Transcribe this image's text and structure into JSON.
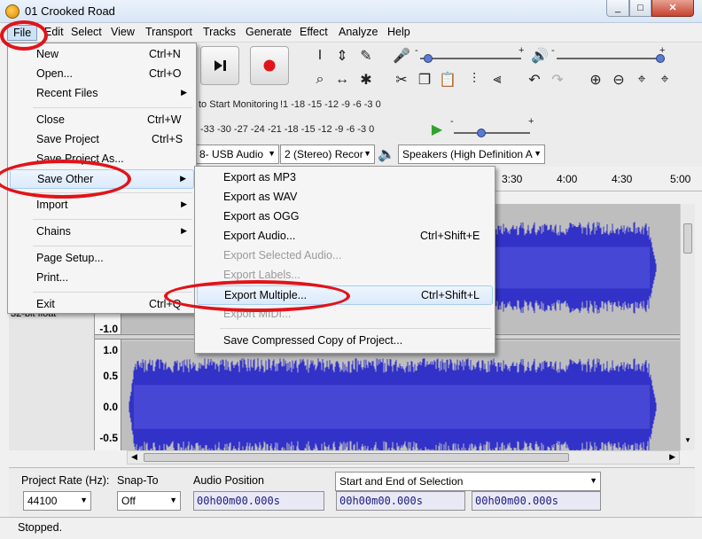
{
  "window": {
    "title": "01 Crooked Road",
    "min": "_",
    "max": "□",
    "close": "✕"
  },
  "menubar": [
    "File",
    "Edit",
    "Select",
    "View",
    "Transport",
    "Tracks",
    "Generate",
    "Effect",
    "Analyze",
    "Help"
  ],
  "file_menu": [
    {
      "label": "New",
      "shortcut": "Ctrl+N"
    },
    {
      "label": "Open...",
      "shortcut": "Ctrl+O"
    },
    {
      "label": "Recent Files",
      "submenu": true
    },
    {
      "label": "Close",
      "shortcut": "Ctrl+W"
    },
    {
      "label": "Save Project",
      "shortcut": "Ctrl+S"
    },
    {
      "label": "Save Project As..."
    },
    {
      "label": "Save Other",
      "submenu": true
    },
    {
      "label": "Import",
      "submenu": true
    },
    {
      "label": "Chains",
      "submenu": true
    },
    {
      "label": "Page Setup..."
    },
    {
      "label": "Print..."
    },
    {
      "label": "Exit",
      "shortcut": "Ctrl+Q"
    }
  ],
  "save_other_menu": [
    {
      "label": "Export as MP3"
    },
    {
      "label": "Export as WAV"
    },
    {
      "label": "Export as OGG"
    },
    {
      "label": "Export Audio...",
      "shortcut": "Ctrl+Shift+E"
    },
    {
      "label": "Export Selected Audio...",
      "disabled": true
    },
    {
      "label": "Export Labels...",
      "disabled": true
    },
    {
      "label": "Export Multiple...",
      "shortcut": "Ctrl+Shift+L"
    },
    {
      "label": "Export MIDI...",
      "disabled": true
    },
    {
      "label": "Save Compressed Copy of Project..."
    }
  ],
  "toolbar": {
    "monitor_text": "to Start Monitoring",
    "rec_scale": "!1 -18 -15 -12  -9  -6  -3  0",
    "play_scale": "-33 -30 -27 -24 -21 -18 -15 -12  -9  -6  -3  0",
    "rec_device": "8- USB Audio",
    "channels": "2 (Stereo) Recor",
    "playback_device": "Speakers (High Definition A",
    "plus": "+",
    "minus": "-"
  },
  "timeline": [
    "3:30",
    "4:00",
    "4:30",
    "5:00"
  ],
  "track": {
    "format": "32-bit float",
    "vlabels_bottom": [
      "-1.0"
    ],
    "vlabels_top": [
      "1.0",
      "0.5",
      "0.0",
      "-0.5"
    ],
    "wave_color": "#3232c8"
  },
  "selection_bar": {
    "rate_label": "Project Rate (Hz):",
    "rate_value": "44100",
    "snap_label": "Snap-To",
    "snap_value": "Off",
    "audio_pos_label": "Audio Position",
    "sel_mode": "Start and End of Selection",
    "time1": "00h00m00.000s",
    "time2": "00h00m00.000s",
    "time3": "00h00m00.000s"
  },
  "status": "Stopped."
}
